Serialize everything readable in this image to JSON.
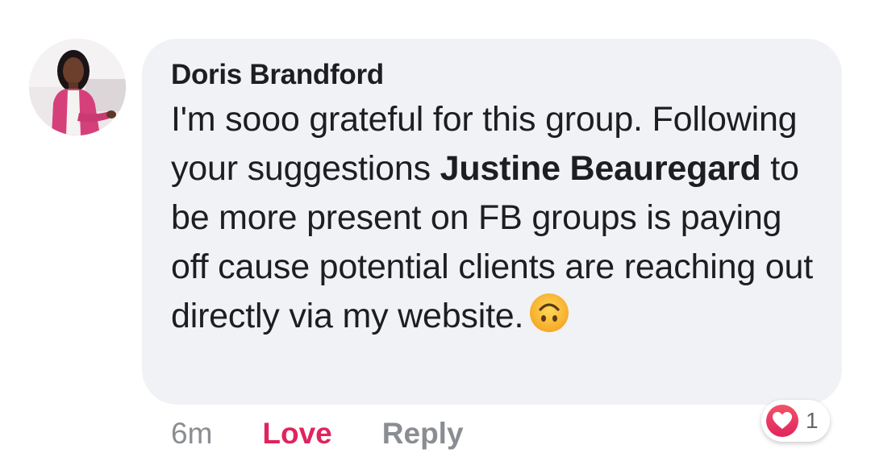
{
  "comment": {
    "author": "Doris Brandford",
    "text_before_mention": "I'm sooo grateful for this group. Following your suggestions ",
    "mention": "Justine Beauregard",
    "text_after_mention": " to be more present on FB groups is paying off cause potential clients are reaching out directly via my website.",
    "emoji_icon": "upside-down-face-emoji"
  },
  "actions": {
    "time": "6m",
    "love_label": "Love",
    "reply_label": "Reply"
  },
  "reactions": {
    "icon": "heart-icon",
    "count": "1"
  },
  "colors": {
    "bubble": "#f0f2f5",
    "love": "#e0245e",
    "muted": "#8a8d91"
  }
}
